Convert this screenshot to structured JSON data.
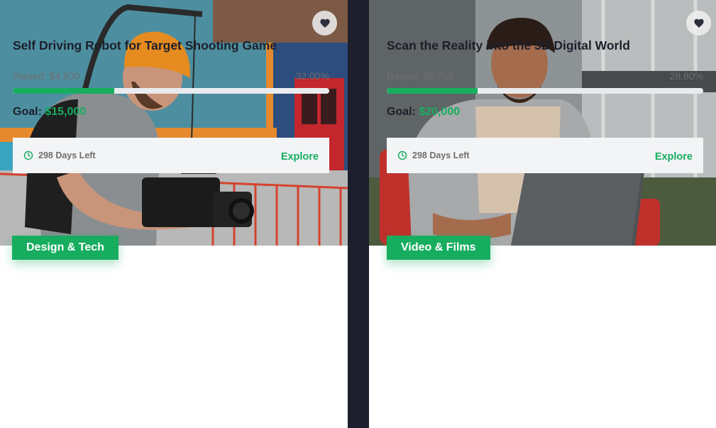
{
  "cards": [
    {
      "category": "Design & Tech",
      "title": "Self Driving Robot for Target Shooting Game",
      "raised_label": "Raised:",
      "raised_amount": "$4,800",
      "percent_text": "32.00%",
      "progress_fraction": 0.32,
      "goal_label": "Goal:",
      "goal_amount": "$15,000",
      "days_left": "298 Days Left",
      "explore_label": "Explore",
      "favorite_icon": "heart-icon",
      "time_icon": "clock-icon"
    },
    {
      "category": "Video & Films",
      "title": "Scan the Reality into the 3D Digital World",
      "raised_label": "Raised:",
      "raised_amount": "$5,760",
      "percent_text": "28.80%",
      "progress_fraction": 0.288,
      "goal_label": "Goal:",
      "goal_amount": "$20,000",
      "days_left": "298 Days Left",
      "explore_label": "Explore",
      "favorite_icon": "heart-icon",
      "time_icon": "clock-icon"
    }
  ],
  "colors": {
    "accent": "#17ad5f",
    "page_background": "#1e1f2c",
    "title_text": "#1d1f2b",
    "muted_text": "#6f6f6f",
    "track": "#e9ebee",
    "footer_bg": "#f3f4f6"
  }
}
